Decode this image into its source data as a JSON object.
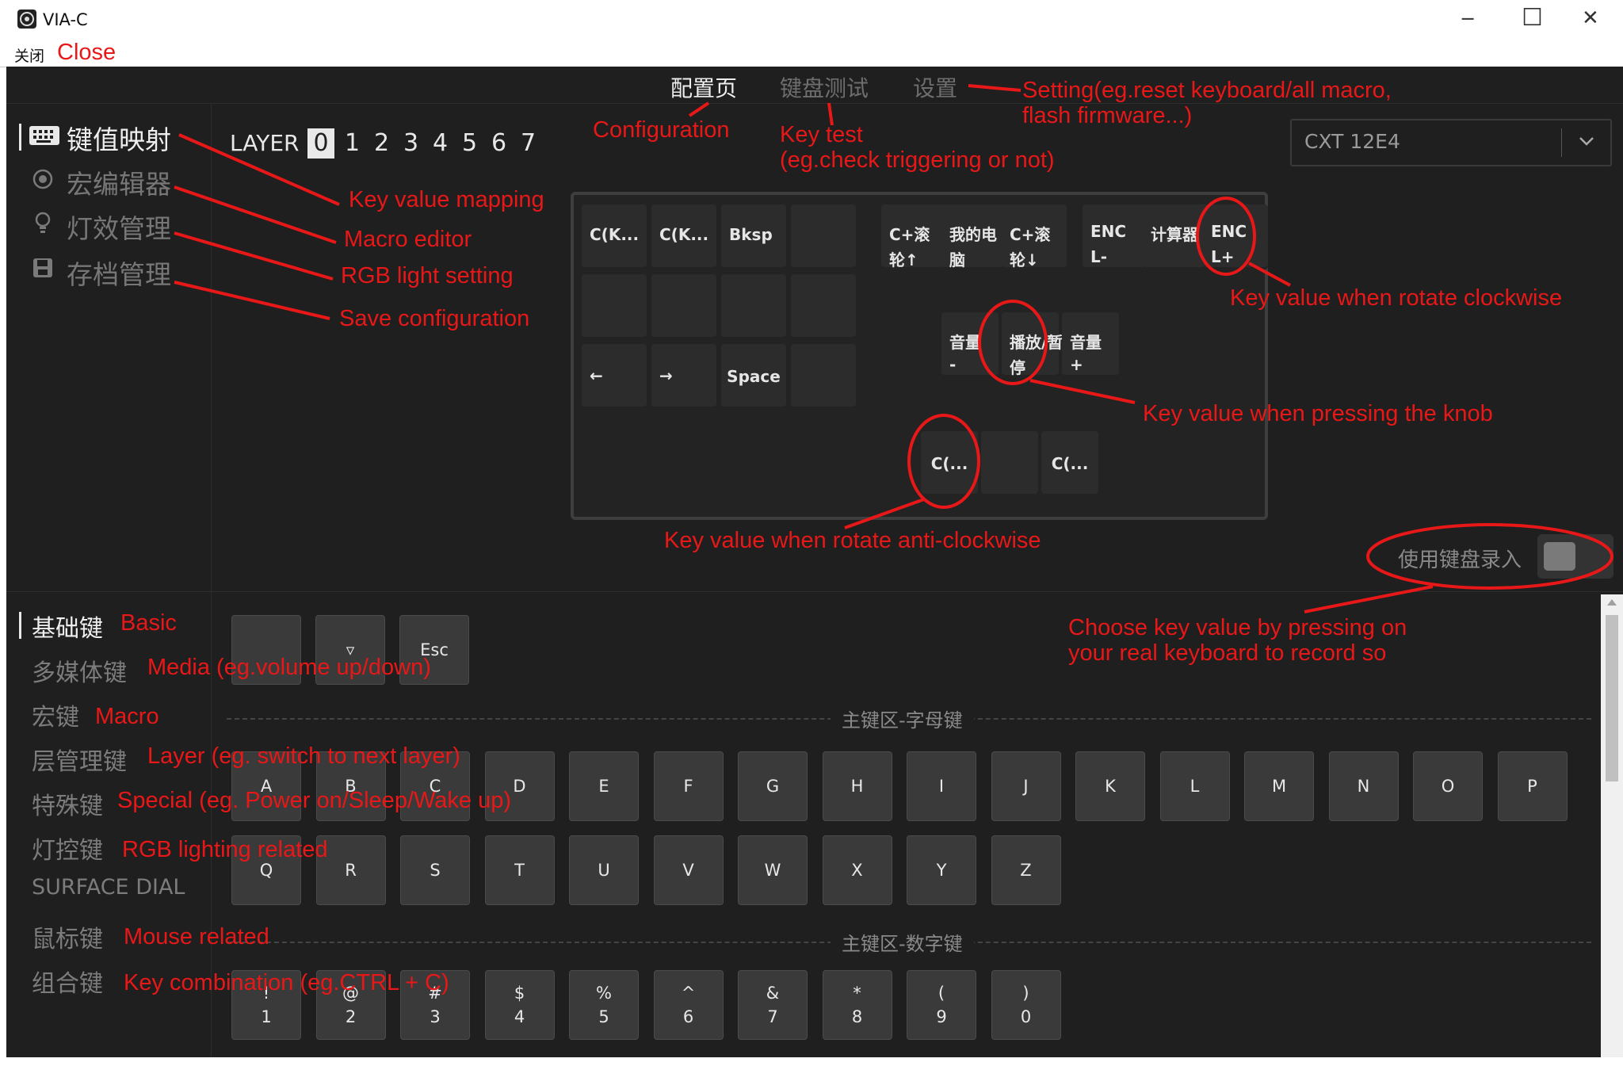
{
  "window": {
    "title": "VIA-C",
    "menu_close": "关闭",
    "controls": {
      "minimize": "─",
      "maximize": "☐",
      "close": "✕"
    }
  },
  "nav": {
    "tabs": [
      "配置页",
      "键盘测试",
      "设置"
    ],
    "active": 0
  },
  "sidebar": {
    "items": [
      {
        "label": "键值映射",
        "icon": "keyboard-icon"
      },
      {
        "label": "宏编辑器",
        "icon": "record-icon"
      },
      {
        "label": "灯效管理",
        "icon": "lightbulb-icon"
      },
      {
        "label": "存档管理",
        "icon": "save-icon"
      }
    ]
  },
  "layers": {
    "label": "LAYER",
    "items": [
      "0",
      "1",
      "2",
      "3",
      "4",
      "5",
      "6",
      "7"
    ],
    "active": "0"
  },
  "device": {
    "name": "CXT 12E4"
  },
  "keymap": {
    "grid": [
      [
        "C(K...",
        "C(K...",
        "Bksp",
        ""
      ],
      [
        "",
        "",
        "",
        ""
      ],
      [
        "←",
        "→",
        "Space",
        ""
      ]
    ],
    "encoders_top": [
      {
        "line1": "C+滚",
        "line2": "轮↑"
      },
      {
        "line1": "我的电",
        "line2": "脑"
      },
      {
        "line1": "C+滚",
        "line2": "轮↓"
      },
      {
        "line1": "ENC",
        "line2": "L-"
      },
      {
        "line1": "计算器",
        "line2": ""
      },
      {
        "line1": "ENC",
        "line2": "L+"
      }
    ],
    "media": [
      {
        "line1": "音量",
        "line2": "-"
      },
      {
        "line1": "播放/暂",
        "line2": "停"
      },
      {
        "line1": "音量",
        "line2": "+"
      }
    ],
    "bottom": [
      "C(...",
      "",
      "C(..."
    ]
  },
  "record_toggle": {
    "label": "使用键盘录入",
    "on": false
  },
  "categories": [
    "基础键",
    "多媒体键",
    "宏键",
    "层管理键",
    "特殊键",
    "灯控键",
    "SURFACE DIAL",
    "鼠标键",
    "组合键"
  ],
  "picker": {
    "top_keys": [
      "",
      "▿",
      "Esc"
    ],
    "section_letters": "主键区-字母键",
    "letters_row1": [
      "A",
      "B",
      "C",
      "D",
      "E",
      "F",
      "G",
      "H",
      "I",
      "J",
      "K",
      "L",
      "M",
      "N",
      "O",
      "P"
    ],
    "letters_row2": [
      "Q",
      "R",
      "S",
      "T",
      "U",
      "V",
      "W",
      "X",
      "Y",
      "Z"
    ],
    "section_numbers": "主键区-数字键",
    "numbers": [
      {
        "top": "!",
        "bottom": "1"
      },
      {
        "top": "@",
        "bottom": "2"
      },
      {
        "top": "#",
        "bottom": "3"
      },
      {
        "top": "$",
        "bottom": "4"
      },
      {
        "top": "%",
        "bottom": "5"
      },
      {
        "top": "^",
        "bottom": "6"
      },
      {
        "top": "&",
        "bottom": "7"
      },
      {
        "top": "*",
        "bottom": "8"
      },
      {
        "top": "(",
        "bottom": "9"
      },
      {
        "top": ")",
        "bottom": "0"
      }
    ]
  },
  "annotations": {
    "close": "Close",
    "configuration": "Configuration",
    "key_test_1": "Key test",
    "key_test_2": "(eg.check triggering or not)",
    "setting_1": "Setting(eg.reset keyboard/all macro,",
    "setting_2": "flash firmware...)",
    "key_value_mapping": "Key value mapping",
    "macro_editor": "Macro editor",
    "rgb_light_setting": "RGB light setting",
    "save_configuration": "Save configuration",
    "rotate_clockwise": "Key value when rotate clockwise",
    "pressing_knob": "Key value when pressing the knob",
    "rotate_anticlockwise": "Key value when rotate anti-clockwise",
    "choose_key_1": "Choose key value by pressing on",
    "choose_key_2": "your real keyboard to record so",
    "basic": "Basic",
    "media": "Media (eg.volume up/down)",
    "macro": "Macro",
    "layer": "Layer (eg. switch to next layer)",
    "special": "Special (eg. Power on/Sleep/Wake up)",
    "rgb_lighting": "RGB lighting related",
    "mouse": "Mouse related",
    "combination": "Key combination (eg.CTRL + C)"
  },
  "colors": {
    "annotation": "#e81818",
    "background": "#1f1f1f",
    "key": "#2c2c2c",
    "picker_key": "#3a3a3a"
  }
}
